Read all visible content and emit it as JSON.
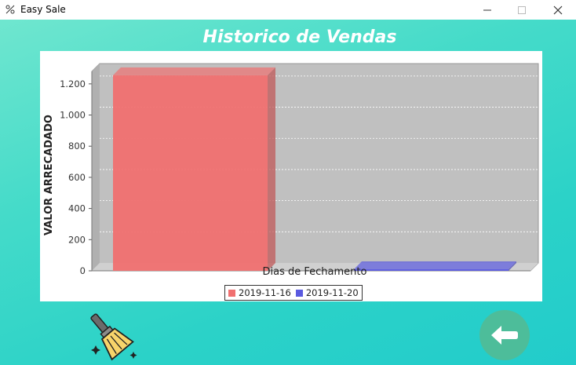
{
  "window": {
    "title": "Easy Sale",
    "controls": {
      "minimize": "minimize-icon",
      "maximize": "maximize-icon",
      "close": "close-icon"
    }
  },
  "page": {
    "title": "Historico de Vendas"
  },
  "chart_data": {
    "type": "bar",
    "style": "3d",
    "title": "",
    "xlabel": "Dias de Fechamento",
    "ylabel": "VALOR ARRECADADO",
    "ylim": [
      0,
      1300
    ],
    "yticks": [
      0,
      200,
      400,
      600,
      800,
      1000,
      1200
    ],
    "ytick_labels": [
      "0",
      "200",
      "400",
      "600",
      "800",
      "1.000",
      "1.200"
    ],
    "grid": true,
    "legend_position": "bottom",
    "series": [
      {
        "name": "2019-11-16",
        "values": [
          1255
        ],
        "color": "#f07070"
      },
      {
        "name": "2019-11-20",
        "values": [
          10
        ],
        "color": "#5a5ae0"
      }
    ]
  },
  "actions": {
    "clear_icon": "broom-icon",
    "back_icon": "arrow-left-icon"
  },
  "colors": {
    "background_start": "#6fe6cf",
    "background_end": "#22cccb",
    "back_button": "#4dbd9a",
    "plot_area": "#c0c0c0"
  }
}
